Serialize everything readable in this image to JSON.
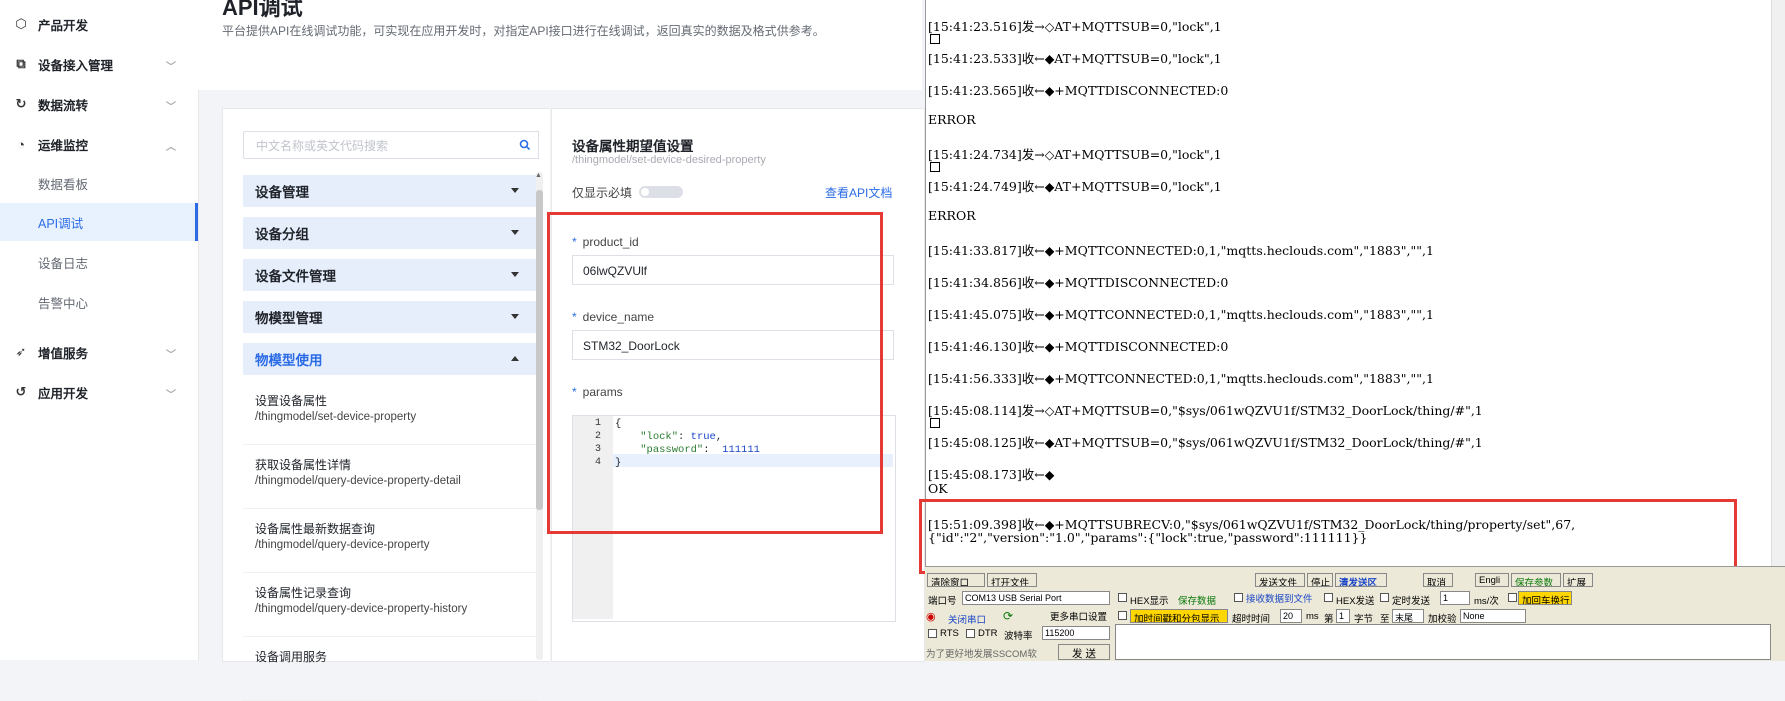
{
  "sidebar": {
    "groups": [
      {
        "label": "产品开发",
        "icon": "cube-icon"
      },
      {
        "label": "设备接入管理",
        "icon": "device-link-icon"
      },
      {
        "label": "数据流转",
        "icon": "flow-icon"
      },
      {
        "label": "运维监控",
        "icon": "monitor-icon"
      },
      {
        "label": "增值服务",
        "icon": "send-icon"
      },
      {
        "label": "应用开发",
        "icon": "app-icon"
      }
    ],
    "subitems": [
      "数据看板",
      "API调试",
      "设备日志",
      "告警中心"
    ]
  },
  "header": {
    "title": "API调试",
    "description": "平台提供API在线调试功能，可实现在应用开发时，对指定API接口进行在线调试，返回真实的数据及格式供参考。"
  },
  "api_list": {
    "search_placeholder": "中文名称或英文代码搜索",
    "categories": [
      "设备管理",
      "设备分组",
      "设备文件管理",
      "物模型管理",
      "物模型使用"
    ],
    "items": [
      {
        "name": "设置设备属性",
        "path": "/thingmodel/set-device-property"
      },
      {
        "name": "获取设备属性详情",
        "path": "/thingmodel/query-device-property-detail"
      },
      {
        "name": "设备属性最新数据查询",
        "path": "/thingmodel/query-device-property"
      },
      {
        "name": "设备属性记录查询",
        "path": "/thingmodel/query-device-property-history"
      },
      {
        "name": "设备调用服务",
        "path": ""
      }
    ]
  },
  "form": {
    "title": "设备属性期望值设置",
    "path": "/thingmodel/set-device-desired-property",
    "required_only_label": "仅显示必填",
    "doc_link": "查看API文档",
    "fields": [
      {
        "label": "product_id",
        "value": "06lwQZVUlf"
      },
      {
        "label": "device_name",
        "value": "STM32_DoorLock"
      },
      {
        "label": "params"
      }
    ],
    "code_line_numbers": [
      "1",
      "2",
      "3",
      "4"
    ],
    "code": {
      "open": "{",
      "k1": "\"lock\"",
      "v1": "true",
      "k2": "\"password\"",
      "v2": "111111",
      "close": "}"
    }
  },
  "terminal": {
    "lines": [
      "[15:41:23.516]发→◇AT+MQTTSUB=0,\"lock\",1",
      "[15:41:23.533]收←◆AT+MQTTSUB=0,\"lock\",1",
      "[15:41:23.565]收←◆+MQTTDISCONNECTED:0",
      "ERROR",
      "[15:41:24.734]发→◇AT+MQTTSUB=0,\"lock\",1",
      "[15:41:24.749]收←◆AT+MQTTSUB=0,\"lock\",1",
      "ERROR",
      "[15:41:33.817]收←◆+MQTTCONNECTED:0,1,\"mqtts.heclouds.com\",\"1883\",\"\",1",
      "[15:41:34.856]收←◆+MQTTDISCONNECTED:0",
      "[15:41:45.075]收←◆+MQTTCONNECTED:0,1,\"mqtts.heclouds.com\",\"1883\",\"\",1",
      "[15:41:46.130]收←◆+MQTTDISCONNECTED:0",
      "[15:41:56.333]收←◆+MQTTCONNECTED:0,1,\"mqtts.heclouds.com\",\"1883\",\"\",1",
      "[15:45:08.114]发→◇AT+MQTTSUB=0,\"$sys/061wQZVU1f/STM32_DoorLock/thing/#\",1",
      "[15:45:08.125]收←◆AT+MQTTSUB=0,\"$sys/061wQZVU1f/STM32_DoorLock/thing/#\",1",
      "[15:45:08.173]收←◆",
      "OK",
      "[15:51:09.398]收←◆+MQTTSUBRECV:0,\"$sys/061wQZVU1f/STM32_DoorLock/thing/property/set\",67,",
      "{\"id\":\"2\",\"version\":\"1.0\",\"params\":{\"lock\":true,\"password\":111111}}"
    ]
  },
  "serial": {
    "clear_window": "清除窗口",
    "open_file": "打开文件",
    "send_file": "发送文件",
    "stop": "停止",
    "clear_send": "清发送区",
    "cancel": "取消",
    "english": "Engli",
    "save_params": "保存参数",
    "expand": "扩展",
    "port_label": "端口号",
    "port_value": "COM13 USB Serial Port",
    "hex_display": "HEX显示",
    "save_data": "保存数据",
    "recv_to_file": "接收数据到文件",
    "hex_send": "HEX发送",
    "timed_send": "定时发送",
    "timed_value": "1",
    "ms_unit": "ms/次",
    "add_crlf": "加回车换行",
    "close_port": "关闭串口",
    "more_settings": "更多串口设置",
    "timestamp": "加时间戳和分包显示",
    "timeout_label": "超时时间",
    "timeout_value": "20",
    "ms": "ms",
    "no_label": "第",
    "no_value": "1",
    "byte_label": "字节",
    "to_label": "至",
    "end_label": "末尾",
    "checksum_label": "加校验",
    "checksum_value": "None",
    "rts": "RTS",
    "dtr": "DTR",
    "baud_label": "波特率",
    "baud_value": "115200",
    "promo": "为了更好地发展SSCOM软",
    "send": "发 送"
  }
}
